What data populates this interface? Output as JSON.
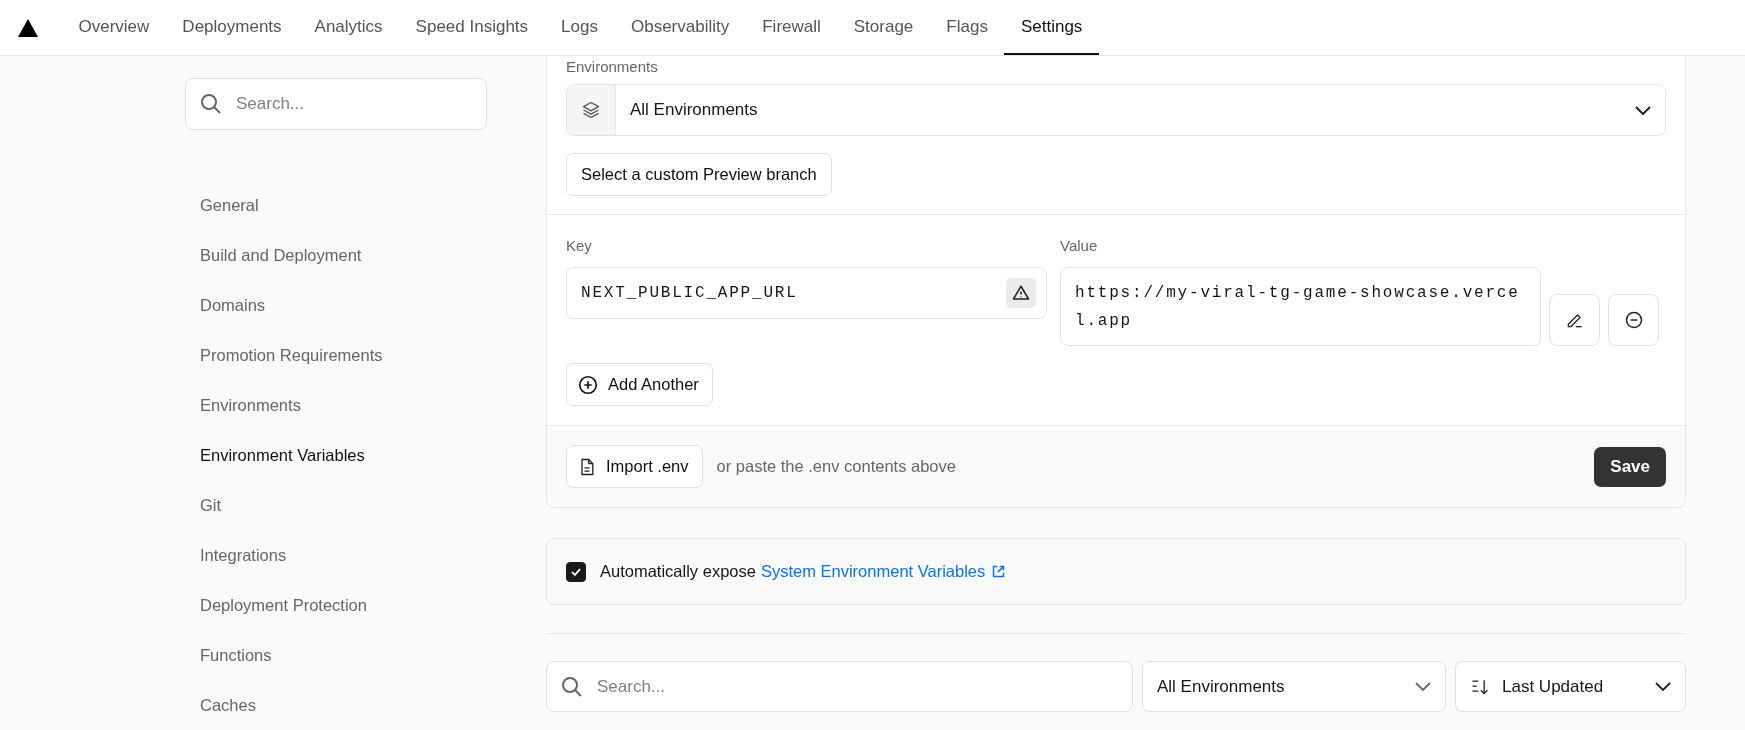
{
  "nav": {
    "tabs": [
      {
        "label": "Overview",
        "selected": false
      },
      {
        "label": "Deployments",
        "selected": false
      },
      {
        "label": "Analytics",
        "selected": false
      },
      {
        "label": "Speed Insights",
        "selected": false
      },
      {
        "label": "Logs",
        "selected": false
      },
      {
        "label": "Observability",
        "selected": false
      },
      {
        "label": "Firewall",
        "selected": false
      },
      {
        "label": "Storage",
        "selected": false
      },
      {
        "label": "Flags",
        "selected": false
      },
      {
        "label": "Settings",
        "selected": true
      }
    ]
  },
  "sidebar": {
    "search": {
      "placeholder": "Search..."
    },
    "items": [
      {
        "label": "General",
        "selected": false
      },
      {
        "label": "Build and Deployment",
        "selected": false
      },
      {
        "label": "Domains",
        "selected": false
      },
      {
        "label": "Promotion Requirements",
        "selected": false
      },
      {
        "label": "Environments",
        "selected": false
      },
      {
        "label": "Environment Variables",
        "selected": true
      },
      {
        "label": "Git",
        "selected": false
      },
      {
        "label": "Integrations",
        "selected": false
      },
      {
        "label": "Deployment Protection",
        "selected": false
      },
      {
        "label": "Functions",
        "selected": false
      },
      {
        "label": "Caches",
        "selected": false
      }
    ]
  },
  "form": {
    "environments_label": "Environments",
    "environment_select": "All Environments",
    "custom_branch_button": "Select a custom Preview branch",
    "key_label": "Key",
    "value_label": "Value",
    "variable": {
      "key": "NEXT_PUBLIC_APP_URL",
      "value": "https://my-viral-tg-game-showcase.vercel.app"
    },
    "add_button": "Add Another",
    "import_button": "Import .env",
    "paste_hint": "or paste the .env contents above",
    "save_button": "Save"
  },
  "expose": {
    "checked": true,
    "text": "Automatically expose",
    "link": "System Environment Variables"
  },
  "filters": {
    "search": {
      "placeholder": "Search..."
    },
    "environment": "All Environments",
    "sort": "Last Updated"
  }
}
